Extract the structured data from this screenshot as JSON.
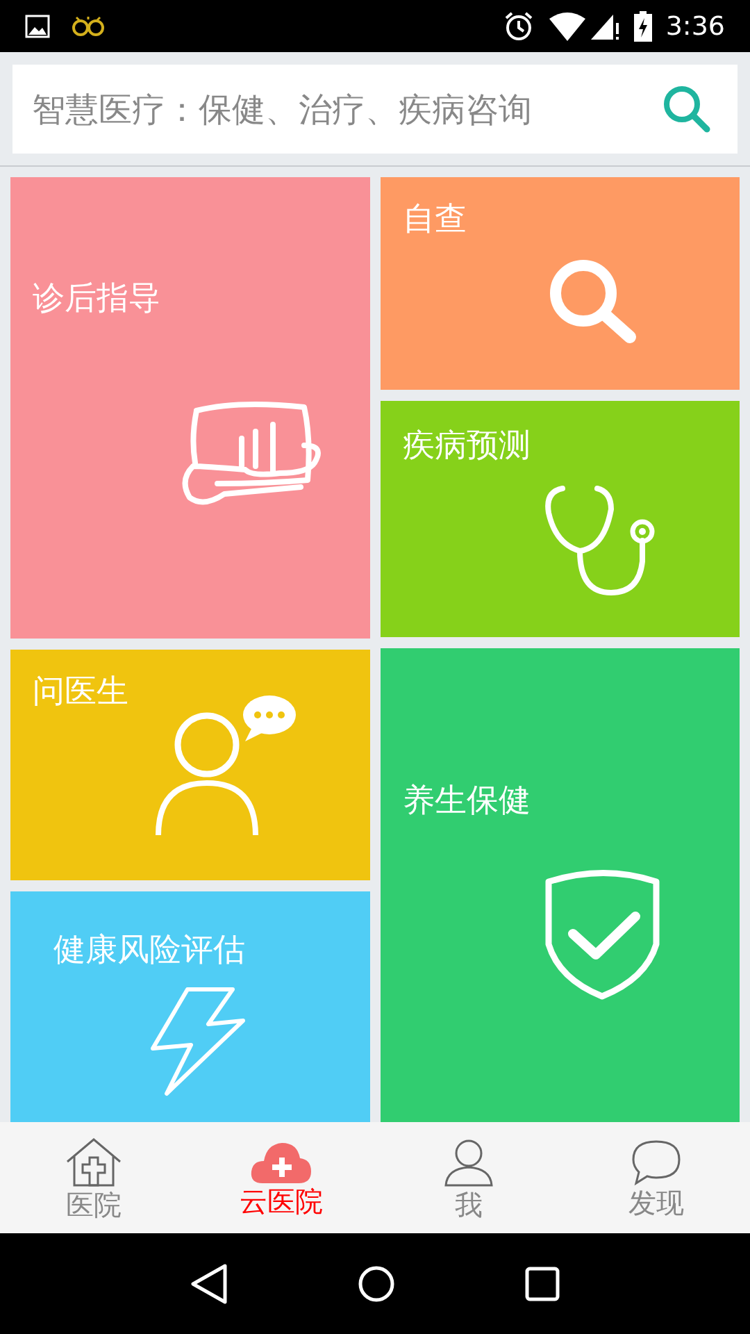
{
  "status_bar": {
    "time": "3:36"
  },
  "search": {
    "placeholder": "智慧医疗：保健、治疗、疾病咨询"
  },
  "tiles": [
    {
      "label": "诊后指导",
      "color": "#f99197",
      "kind": "guide"
    },
    {
      "label": "自查",
      "color": "#fe9a63",
      "kind": "check"
    },
    {
      "label": "疾病预测",
      "color": "#86d11a",
      "kind": "predict"
    },
    {
      "label": "问医生",
      "color": "#f0c40f",
      "kind": "doctor"
    },
    {
      "label": "养生保健",
      "color": "#31cd70",
      "kind": "health"
    },
    {
      "label": "健康风险评估",
      "color": "#50cdf5",
      "kind": "risk"
    }
  ],
  "tabs": [
    {
      "label": "医院",
      "selected": false,
      "kind": "hospital"
    },
    {
      "label": "云医院",
      "selected": true,
      "kind": "cloud"
    },
    {
      "label": "我",
      "selected": false,
      "kind": "me"
    },
    {
      "label": "发现",
      "selected": false,
      "kind": "discover"
    }
  ]
}
